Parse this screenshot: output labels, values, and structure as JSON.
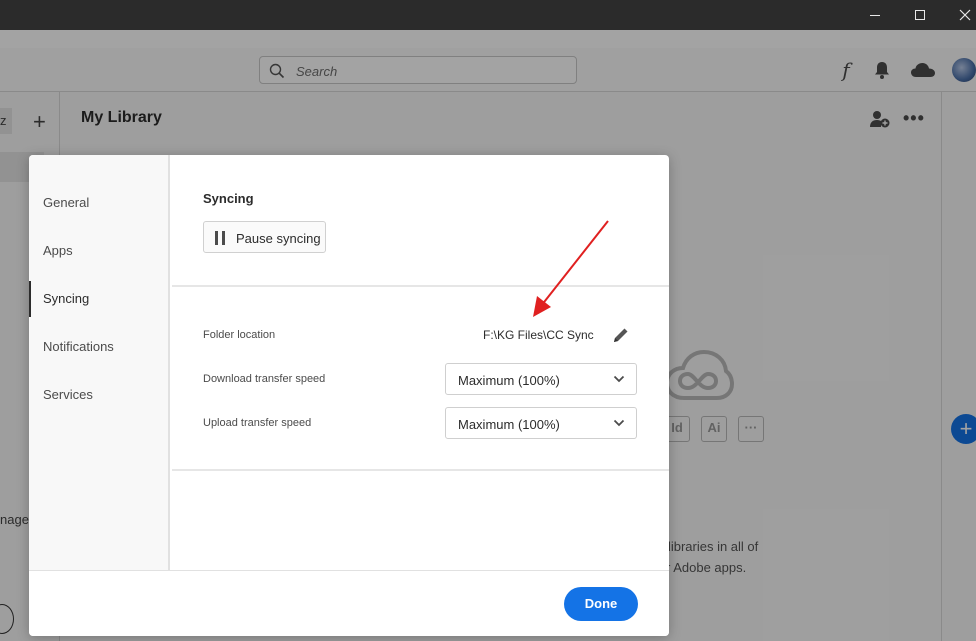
{
  "window": {
    "minimize_glyph": "",
    "maximize_glyph": "",
    "close_glyph": "✕"
  },
  "topbar": {
    "search_placeholder": "Search",
    "fonts_glyph": "f"
  },
  "library": {
    "title": "My Library",
    "more_glyph": "•••",
    "left_chip_text": "z",
    "add_glyph": "+",
    "left_snippet": "nage"
  },
  "empty_state": {
    "line1": "r libraries in all of",
    "line2": "r Adobe apps.",
    "app_badges": [
      "Id",
      "Ai",
      "···"
    ]
  },
  "fab_glyph": "+",
  "preferences": {
    "nav_items": [
      "General",
      "Apps",
      "Syncing",
      "Notifications",
      "Services"
    ],
    "active_nav": "Syncing",
    "section_title": "Syncing",
    "pause_label": "Pause syncing",
    "folder_label": "Folder location",
    "folder_path": "F:\\KG Files\\CC Sync",
    "download_label": "Download transfer speed",
    "download_value": "Maximum (100%)",
    "upload_label": "Upload transfer speed",
    "upload_value": "Maximum (100%)",
    "done_label": "Done"
  },
  "colors": {
    "accent": "#1473e6",
    "annotation": "#e02020"
  },
  "icons": [
    "search-icon",
    "bell-icon",
    "cloud-icon",
    "add-user-icon",
    "pause-icon",
    "edit-icon",
    "chevron-down-icon",
    "creative-cloud-logo-icon"
  ]
}
